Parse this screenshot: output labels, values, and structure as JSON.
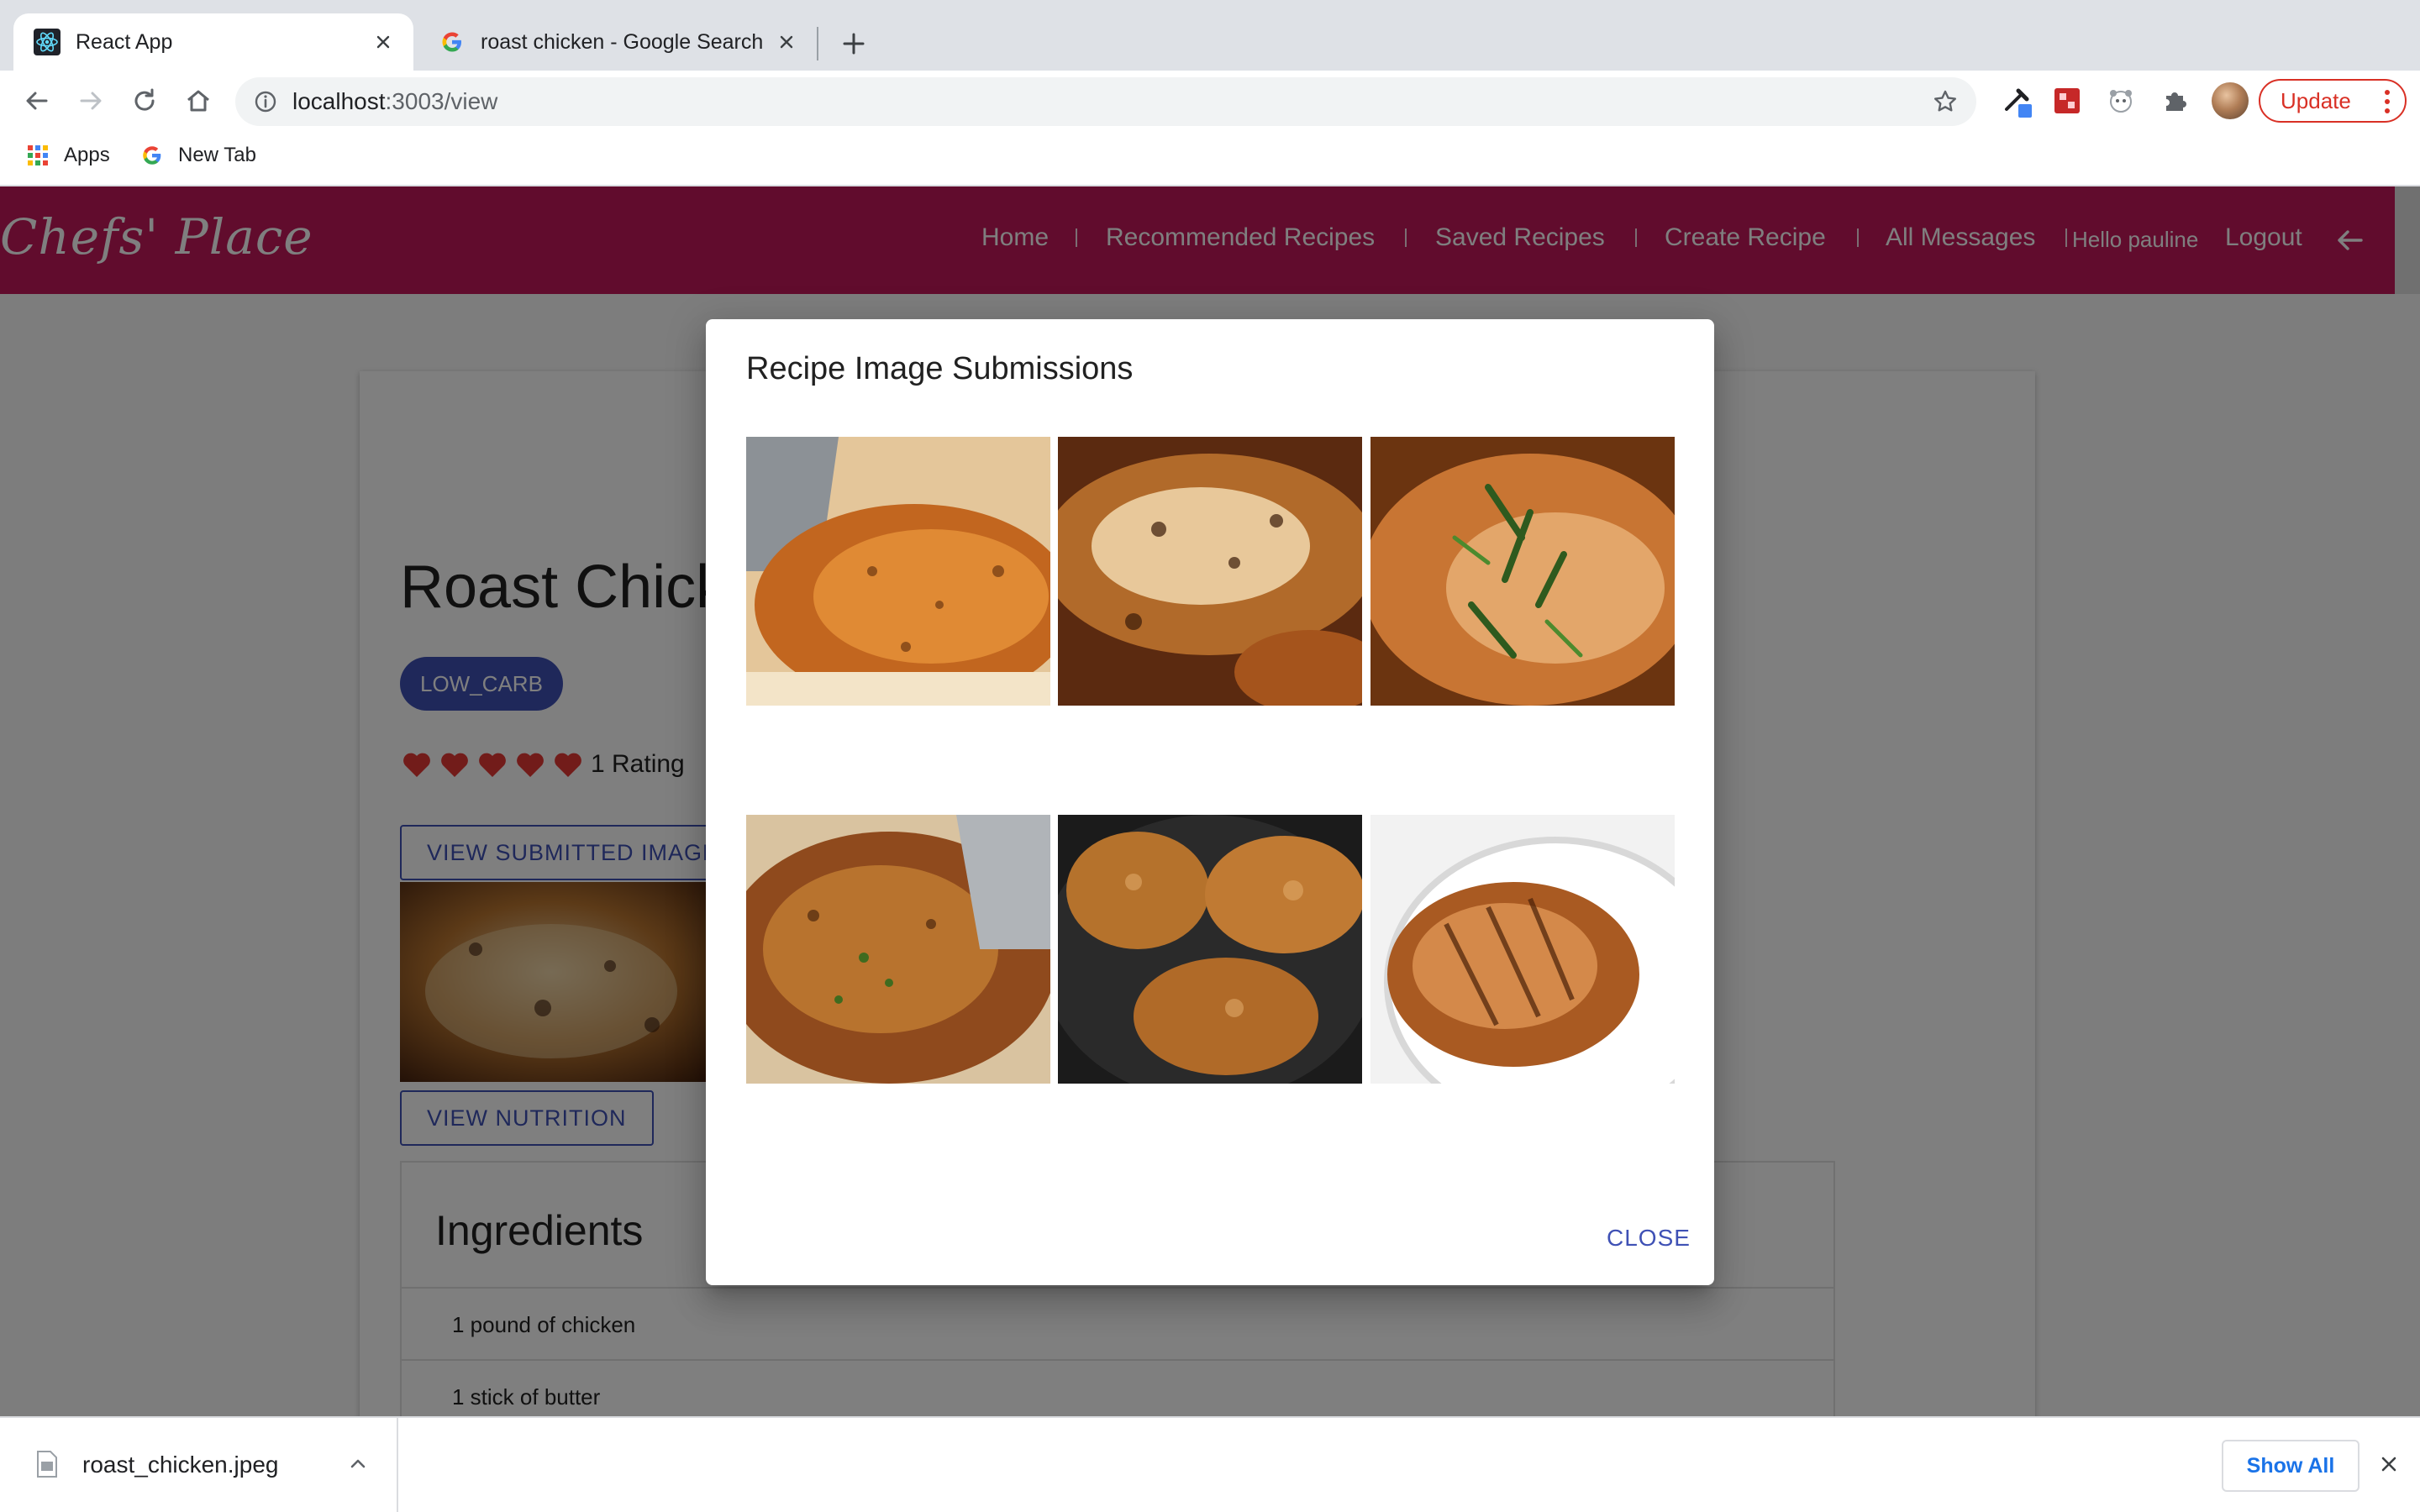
{
  "browser": {
    "tabs": [
      {
        "title": "React App",
        "active": true
      },
      {
        "title": "roast chicken - Google Search",
        "active": false
      }
    ],
    "url": {
      "host": "localhost",
      "path": ":3003/view"
    },
    "update_label": "Update",
    "bookmarks": [
      {
        "label": "Apps",
        "icon": "apps-grid-icon"
      },
      {
        "label": "New Tab",
        "icon": "google-g-icon"
      }
    ]
  },
  "app": {
    "brand": "Chefs' Place",
    "nav": {
      "home": "Home",
      "recommended": "Recommended Recipes",
      "saved": "Saved Recipes",
      "create": "Create Recipe",
      "messages": "All Messages",
      "hello": "Hello pauline",
      "logout": "Logout"
    },
    "brand_color": "#c2185b",
    "primary_color": "#3f51b5"
  },
  "recipe": {
    "title": "Roast Chicken",
    "tag": "LOW_CARB",
    "rating_hearts": 5,
    "rating_text": "1 Rating",
    "view_images_label": "VIEW SUBMITTED IMAGES",
    "view_nutrition_label": "VIEW NUTRITION",
    "ingredients_title": "Ingredients",
    "ingredients": [
      "1 pound of chicken",
      "1 stick of butter"
    ]
  },
  "dialog": {
    "title": "Recipe Image Submissions",
    "close_label": "CLOSE",
    "image_count": 6
  },
  "downloads": {
    "file": "roast_chicken.jpeg",
    "show_all": "Show All"
  }
}
